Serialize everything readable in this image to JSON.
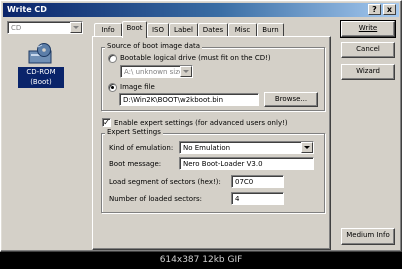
{
  "window": {
    "title": "Write CD",
    "help_glyph": "?",
    "close_glyph": "x"
  },
  "drive_selector": {
    "value": "CD"
  },
  "device": {
    "line1": "CD-ROM",
    "line2": "(Boot)"
  },
  "tabs": [
    {
      "label": "Info"
    },
    {
      "label": "Boot"
    },
    {
      "label": "ISO"
    },
    {
      "label": "Label"
    },
    {
      "label": "Dates"
    },
    {
      "label": "Misc"
    },
    {
      "label": "Burn"
    }
  ],
  "active_tab": "Boot",
  "boot_source": {
    "group_label": "Source of boot image data",
    "option_drive_label": "Bootable logical drive (must fit on the CD!)",
    "drive_combo_value": "A:\\  unknown size",
    "option_image_label": "Image file",
    "image_path": "D:\\Win2K\\BOOT\\w2kboot.bin",
    "browse_label": "Browse...",
    "selected": "image_file"
  },
  "expert_toggle": {
    "label": "Enable expert settings (for advanced users only!)",
    "checked": true,
    "check_glyph": "✓"
  },
  "expert": {
    "group_label": "Expert Settings",
    "emulation_label": "Kind of emulation:",
    "emulation_value": "No Emulation",
    "boot_message_label": "Boot message:",
    "boot_message_value": "Nero Boot-Loader V3.0",
    "load_segment_label": "Load segment of sectors (hex!):",
    "load_segment_value": "07C0",
    "sectors_label": "Number of loaded sectors:",
    "sectors_value": "4"
  },
  "buttons": {
    "write": "Write",
    "cancel": "Cancel",
    "wizard": "Wizard",
    "medium_info": "Medium Info"
  },
  "footer": {
    "caption": "614x387 12kb GIF"
  }
}
